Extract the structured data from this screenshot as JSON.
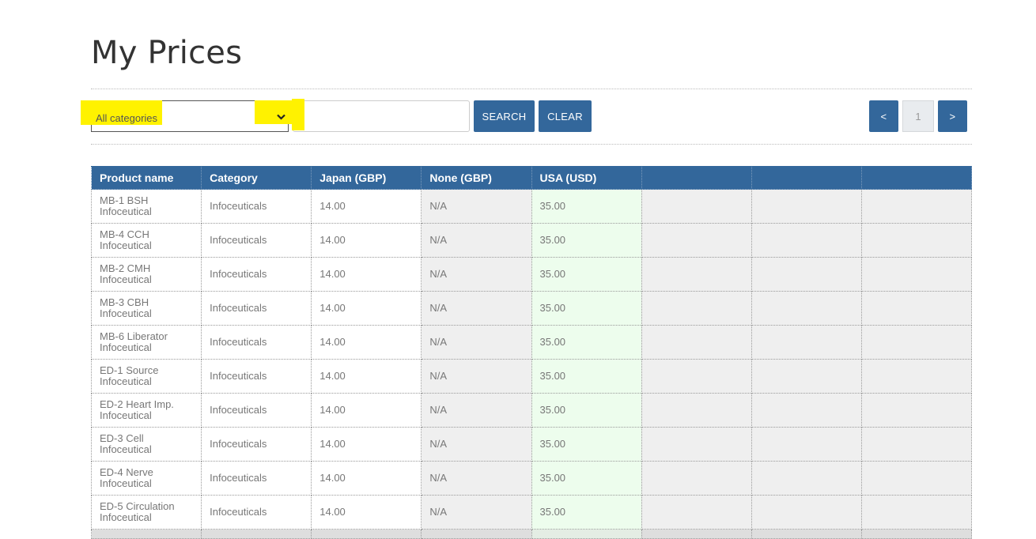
{
  "page_title": "My Prices",
  "filters": {
    "category_selected": "All categories",
    "search_value": "",
    "search_label": "SEARCH",
    "clear_label": "CLEAR"
  },
  "pagination": {
    "prev_label": "<",
    "current_page": "1",
    "next_label": ">"
  },
  "table": {
    "columns": [
      "Product name",
      "Category",
      "Japan (GBP)",
      "None (GBP)",
      "USA (USD)",
      "",
      "",
      ""
    ],
    "rows": [
      {
        "name": "MB-1 BSH",
        "name_sub": "Infoceutical",
        "category": "Infoceuticals",
        "japan": "14.00",
        "none": "N/A",
        "usa": "35.00"
      },
      {
        "name": "MB-4 CCH",
        "name_sub": "Infoceutical",
        "category": "Infoceuticals",
        "japan": "14.00",
        "none": "N/A",
        "usa": "35.00"
      },
      {
        "name": "MB-2 CMH",
        "name_sub": "Infoceutical",
        "category": "Infoceuticals",
        "japan": "14.00",
        "none": "N/A",
        "usa": "35.00"
      },
      {
        "name": "MB-3 CBH",
        "name_sub": "Infoceutical",
        "category": "Infoceuticals",
        "japan": "14.00",
        "none": "N/A",
        "usa": "35.00"
      },
      {
        "name": "MB-6 Liberator",
        "name_sub": "Infoceutical",
        "category": "Infoceuticals",
        "japan": "14.00",
        "none": "N/A",
        "usa": "35.00"
      },
      {
        "name": "ED-1 Source",
        "name_sub": "Infoceutical",
        "category": "Infoceuticals",
        "japan": "14.00",
        "none": "N/A",
        "usa": "35.00"
      },
      {
        "name": "ED-2 Heart Imp.",
        "name_sub": "Infoceutical",
        "category": "Infoceuticals",
        "japan": "14.00",
        "none": "N/A",
        "usa": "35.00"
      },
      {
        "name": "ED-3 Cell",
        "name_sub": "Infoceutical",
        "category": "Infoceuticals",
        "japan": "14.00",
        "none": "N/A",
        "usa": "35.00"
      },
      {
        "name": "ED-4 Nerve",
        "name_sub": "Infoceutical",
        "category": "Infoceuticals",
        "japan": "14.00",
        "none": "N/A",
        "usa": "35.00"
      },
      {
        "name": "ED-5 Circulation",
        "name_sub": "Infoceutical",
        "category": "Infoceuticals",
        "japan": "14.00",
        "none": "N/A",
        "usa": "35.00"
      }
    ]
  },
  "colors": {
    "accent": "#33679b",
    "highlight": "#fff200",
    "usd_cell": "#edfded",
    "empty_cell": "#efefef"
  },
  "icons": {
    "select_arrow": "chevron-down-icon"
  }
}
